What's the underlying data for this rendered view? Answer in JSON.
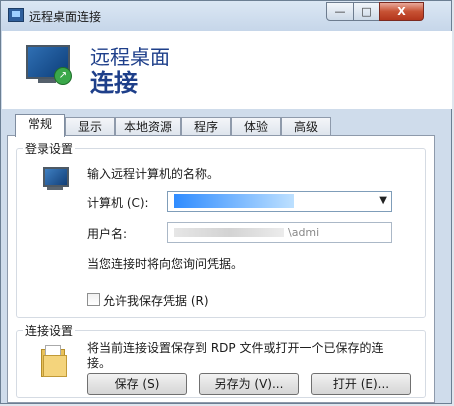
{
  "window": {
    "title": "远程桌面连接",
    "controls": {
      "minimize": "—",
      "maximize": "□",
      "close": "X"
    }
  },
  "header": {
    "line1": "远程桌面",
    "line2": "连接"
  },
  "tabs": [
    {
      "label": "常规",
      "active": true
    },
    {
      "label": "显示",
      "active": false
    },
    {
      "label": "本地资源",
      "active": false
    },
    {
      "label": "程序",
      "active": false
    },
    {
      "label": "体验",
      "active": false
    },
    {
      "label": "高级",
      "active": false
    }
  ],
  "login": {
    "group_title": "登录设置",
    "prompt": "输入远程计算机的名称。",
    "computer_label": "计算机 (C):",
    "computer_value": "",
    "username_label": "用户名:",
    "username_value": "\\admi",
    "credentials_note": "当您连接时将向您询问凭据。",
    "save_credentials_label": "允许我保存凭据 (R)",
    "save_credentials_checked": false
  },
  "connection": {
    "group_title": "连接设置",
    "description": "将当前连接设置保存到 RDP 文件或打开一个已保存的连接。",
    "save_button": "保存 (S)",
    "save_as_button": "另存为 (V)...",
    "open_button": "打开 (E)..."
  },
  "icons": {
    "app": "remote-desktop-icon",
    "header": "remote-desktop-monitor-icon",
    "computer": "computer-icon",
    "folder": "folder-icon",
    "dropdown": "chevron-down-icon"
  }
}
